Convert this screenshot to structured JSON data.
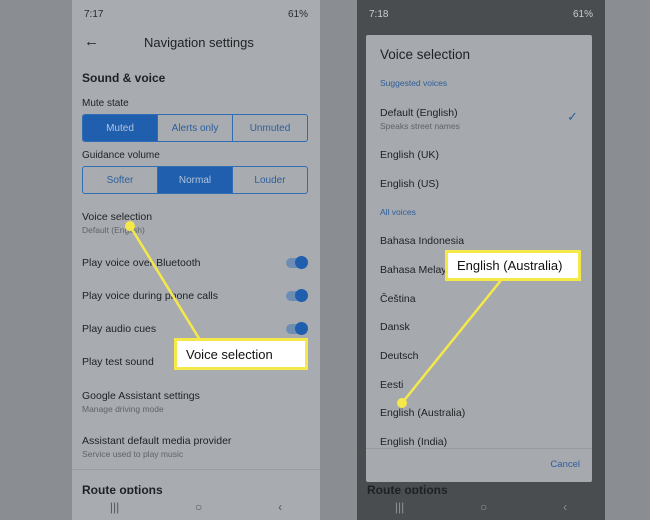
{
  "left": {
    "time": "7:17",
    "battery": "61%",
    "title": "Navigation settings",
    "section": "Sound & voice",
    "mute_label": "Mute state",
    "mute_options": [
      "Muted",
      "Alerts only",
      "Unmuted"
    ],
    "volume_label": "Guidance volume",
    "volume_options": [
      "Softer",
      "Normal",
      "Louder"
    ],
    "voice_selection": "Voice selection",
    "voice_selection_sub": "Default (English)",
    "bluetooth": "Play voice over Bluetooth",
    "phone_calls": "Play voice during phone calls",
    "audio_cues": "Play audio cues",
    "test_sound": "Play test sound",
    "assistant": "Google Assistant settings",
    "assistant_sub": "Manage driving mode",
    "media": "Assistant default media provider",
    "media_sub": "Service used to play music",
    "route": "Route options"
  },
  "right": {
    "time": "7:18",
    "battery": "61%",
    "dialog_title": "Voice selection",
    "suggested": "Suggested voices",
    "default_voice": "Default (English)",
    "default_sub": "Speaks street names",
    "uk": "English (UK)",
    "us": "English (US)",
    "all": "All voices",
    "voices": [
      "Bahasa Indonesia",
      "Bahasa Melayu",
      "Čeština",
      "Dansk",
      "Deutsch",
      "Eesti",
      "English (Australia)",
      "English (India)"
    ],
    "cancel": "Cancel",
    "route": "Route options"
  },
  "callouts": {
    "left": "Voice selection",
    "right": "English (Australia)"
  },
  "nav": {
    "recent": "|||",
    "home": "○",
    "back": "‹"
  },
  "colors": {
    "accent": "#1f5fae",
    "callout_border": "#f5e94a"
  }
}
